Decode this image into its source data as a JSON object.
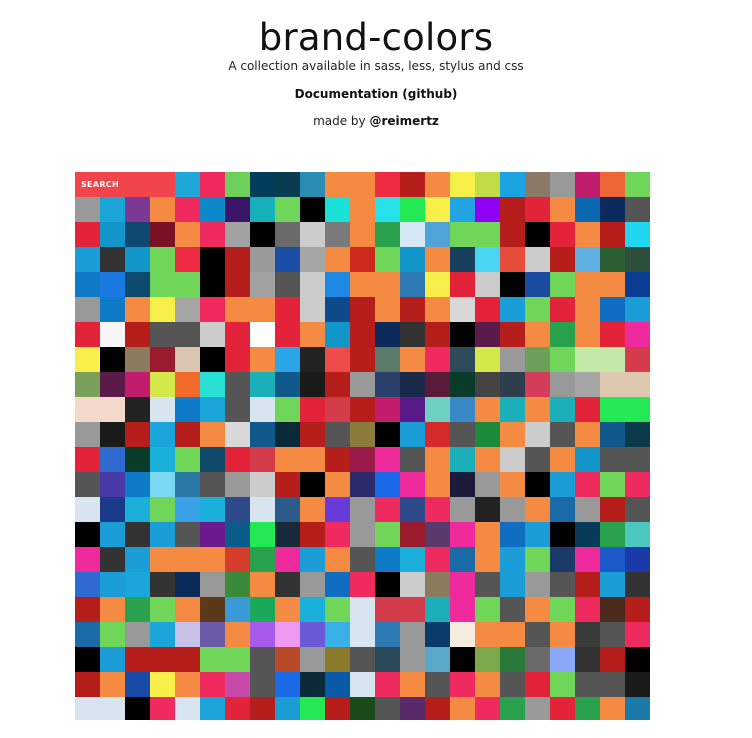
{
  "header": {
    "title": "brand-colors",
    "subtitle": "A collection available in sass, less, stylus and css",
    "documentation_link": "Documentation (github)",
    "made_by_prefix": "made by ",
    "made_by_handle": "@reimertz"
  },
  "search": {
    "placeholder": "SEARCH",
    "background_color": "#f2454b"
  },
  "palette": {
    "columns": 23,
    "first_row_after_search": [
      "#1ea8da",
      "#ee2a5e",
      "#6dd05a",
      "#043c5b",
      "#0a3c4f",
      "#2b8db4",
      "#f58a42",
      "#f58a42",
      "#ef2b43",
      "#b51e1b",
      "#f58a42",
      "#f9ef4b",
      "#c0dc46",
      "#1ba4e1",
      "#8a7a67",
      "#999999",
      "#c21d6c",
      "#ee6537",
      "#6fd65a"
    ],
    "colors": [
      "#999999",
      "#1ba6d9",
      "#7b3894",
      "#f58a42",
      "#ee2a5e",
      "#0c89c9",
      "#3c1568",
      "#15b0b9",
      "#6fd65a",
      "#000000",
      "#1be0d6",
      "#f58a42",
      "#26e2e8",
      "#25e855",
      "#f9ef4b",
      "#22a4e3",
      "#8f00f5",
      "#b51e1b",
      "#e2233a",
      "#f58a42",
      "#0c6ab3",
      "#0c2a5c",
      "#555555",
      "#e2233a",
      "#1296c9",
      "#0f4870",
      "#7a1225",
      "#f58a42",
      "#ee2a5e",
      "#a2a2a2",
      "#000000",
      "#6a6a6a",
      "#cccccc",
      "#7a7a7a",
      "#f58a42",
      "#2aa14d",
      "#d4e9f5",
      "#4fa3d9",
      "#6fd65a",
      "#6fd65a",
      "#b51e1b",
      "#000000",
      "#e2233a",
      "#f58a42",
      "#b51e1b",
      "#21d6f0",
      "#1b9dd7",
      "#333333",
      "#1296c9",
      "#6fd65a",
      "#ef2b43",
      "#000000",
      "#b51e1b",
      "#9a9a9a",
      "#1b4ea6",
      "#a5a5a5",
      "#f58a42",
      "#cc2a1c",
      "#6fd65a",
      "#1296c9",
      "#f58a42",
      "#1a3f5c",
      "#4ad5f5",
      "#e64c3a",
      "#cccccc",
      "#b51e1b",
      "#5fb0e0",
      "#2e5e34",
      "#2c4e3a",
      "#0f7bc8",
      "#1b7ae2",
      "#0c4a6e",
      "#6fd65a",
      "#6fd65a",
      "#000000",
      "#b51e1b",
      "#a2a2a2",
      "#555555",
      "#cccccc",
      "#1e88e5",
      "#f58a42",
      "#f58a42",
      "#2e7ab5",
      "#f9ef4b",
      "#e2233a",
      "#cccccc",
      "#000000",
      "#1a4ba0",
      "#6fd65a",
      "#f58a42",
      "#f58a42",
      "#0b3e93",
      "#999999",
      "#0f7bc8",
      "#f58a42",
      "#f9ef4b",
      "#a5a5a5",
      "#ee2a5e",
      "#f58a42",
      "#f58a42",
      "#e2233a",
      "#cccccc",
      "#0f4a8a",
      "#b51e1b",
      "#f58a42",
      "#b51e1b",
      "#f58a42",
      "#d8d8d8",
      "#e2233a",
      "#1b9dd7",
      "#6fd65a",
      "#e2233a",
      "#f58a42",
      "#0f6ec2",
      "#1b9dd7",
      "#e2233a",
      "#f6f6f6",
      "#b51e1b",
      "#555555",
      "#555555",
      "#cccccc",
      "#e2233a",
      "#ffffff",
      "#e2233a",
      "#f58a42",
      "#1296c9",
      "#b51e1b",
      "#0c2a5c",
      "#333333",
      "#b51e1b",
      "#000000",
      "#5b1b4a",
      "#b51e1b",
      "#f58a42",
      "#2aa14d",
      "#f58a42",
      "#e2233a",
      "#ee2a9c",
      "#f9ef4b",
      "#000000",
      "#8b7c5e",
      "#9a1b2e",
      "#d8c6b0",
      "#000000",
      "#e2233a",
      "#f58a42",
      "#2aa6e8",
      "#222222",
      "#ef4b4b",
      "#b51e1b",
      "#5a7a6a",
      "#f58a42",
      "#ee2a5e",
      "#2e4a5a",
      "#d4e84a",
      "#999999",
      "#6ca05a",
      "#6fd65a",
      "#c3e9a8",
      "#c3e9a8",
      "#d43c4c",
      "#7aa05a",
      "#5a1b4a",
      "#c21d6c",
      "#d4e84a",
      "#f26a2c",
      "#28e0d4",
      "#555555",
      "#1bb0b9",
      "#0f5a8a",
      "#1a1a1a",
      "#b51e1b",
      "#999999",
      "#2a3f6a",
      "#1a2a4a",
      "#5a1b3a",
      "#0a3a2a",
      "#444444",
      "#2e3e4e",
      "#d43c5c",
      "#999999",
      "#a5a5a5",
      "#dfc8b0",
      "#dfc8b0",
      "#f5d8cc",
      "#f5d8cc",
      "#222222",
      "#d8e4ef",
      "#0f7bc8",
      "#1ba6d9",
      "#555555",
      "#d8e4ef",
      "#6fd65a",
      "#e2233a",
      "#d43c4c",
      "#b51e1b",
      "#c21d6c",
      "#5a1b8a",
      "#6dd0c0",
      "#3a88c8",
      "#f58a42",
      "#1bb0b9",
      "#f58a42",
      "#1bb0b9",
      "#e2233a",
      "#25e855",
      "#25e855",
      "#999999",
      "#1a1a1a",
      "#b51e1b",
      "#1ba6d9",
      "#b51e1b",
      "#f58a42",
      "#d8d8d8",
      "#0f5a8a",
      "#0a2a3a",
      "#b51e1b",
      "#555555",
      "#8b7c3e",
      "#000000",
      "#1b9dd7",
      "#d42a2a",
      "#555555",
      "#1b8a3a",
      "#f58a42",
      "#cccccc",
      "#555555",
      "#f58a42",
      "#0f5a8a",
      "#0a3a4a",
      "#e2233a",
      "#2e6ad0",
      "#0a3a2a",
      "#1bb0d9",
      "#6fd65a",
      "#0f4a6a",
      "#e2233a",
      "#d43c4c",
      "#f58a42",
      "#f58a42",
      "#b51e1b",
      "#9a1b4a",
      "#ee2a9c",
      "#555555",
      "#f58a42",
      "#1bb0b9",
      "#f58a42",
      "#cccccc",
      "#555555",
      "#f58a42",
      "#1296c9",
      "#555555",
      "#555555",
      "#555555",
      "#4a3aa8",
      "#0f7bc8",
      "#7ad8f0",
      "#2a7aa8",
      "#555555",
      "#999999",
      "#cccccc",
      "#b51e1b",
      "#000000",
      "#f58a42",
      "#2a2a6a",
      "#1a6ae8",
      "#ee2a9c",
      "#f58a42",
      "#1a1a3a",
      "#999999",
      "#f58a42",
      "#000000",
      "#1b9dd7",
      "#ee2a5e",
      "#6fd65a",
      "#ee2a5e",
      "#d8e4ef",
      "#1a3a8a",
      "#1bb0d9",
      "#6fd65a",
      "#3aa0e8",
      "#1bb0d9",
      "#2e4a8a",
      "#d8e4ef",
      "#2e5a8a",
      "#f58a42",
      "#6a3ad8",
      "#999999",
      "#ee2a5e",
      "#2e4a8a",
      "#ee2a5e",
      "#999999",
      "#222222",
      "#999999",
      "#f58a42",
      "#1a6aa8",
      "#999999",
      "#b51e1b",
      "#555555",
      "#000000",
      "#1b9dd7",
      "#333333",
      "#1b9dd7",
      "#555555",
      "#6a1a8a",
      "#0a5a8a",
      "#25e855",
      "#1a2a3a",
      "#b51e1b",
      "#ee2a5e",
      "#999999",
      "#6fd65a",
      "#9a1b2e",
      "#5a3a6a",
      "#ee2a9c",
      "#f58a42",
      "#0f6ec2",
      "#1b9dd7",
      "#000000",
      "#0a3a5a",
      "#2aa14d",
      "#4ac8c0",
      "#ee2a9c",
      "#333333",
      "#1b9dd7",
      "#f58a42",
      "#f58a42",
      "#f58a42",
      "#d43c2c",
      "#2aa14d",
      "#ee2a9c",
      "#1b9dd7",
      "#f58a42",
      "#555555",
      "#0f7bc8",
      "#1bb0d9",
      "#ee2a5e",
      "#1a6aa8",
      "#f58a42",
      "#1b9dd7",
      "#6fd65a",
      "#1a3a6a",
      "#ee2a9c",
      "#1b5ac8",
      "#1a3aa8",
      "#2e6ad0",
      "#1b9dd7",
      "#1ba6d9",
      "#333333",
      "#0a2a5a",
      "#999999",
      "#3a8a3a",
      "#f58a42",
      "#333333",
      "#999999",
      "#0f6ec2",
      "#ee2a5e",
      "#000000",
      "#cccccc",
      "#8b7c5e",
      "#ee2a9c",
      "#555555",
      "#1b9dd7",
      "#999999",
      "#555555",
      "#b51e1b",
      "#1b9dd7",
      "#333333",
      "#b51e1b",
      "#f58a42",
      "#2aa14d",
      "#6fd65a",
      "#f58a42",
      "#5a3a1a",
      "#3a9ad8",
      "#1aa85a",
      "#f58a42",
      "#1bb0d9",
      "#6fd65a",
      "#d8e4ef",
      "#d43c4c",
      "#d43c4c",
      "#1bb0b9",
      "#ee2a9c",
      "#6fd65a",
      "#555555",
      "#f58a42",
      "#6fd65a",
      "#ee2a5e",
      "#4a2a1a",
      "#b51e1b",
      "#1a6aa8",
      "#6fd65a",
      "#999999",
      "#1ba6d9",
      "#c8c0e8",
      "#6a5aa8",
      "#f58a42",
      "#a85ae8",
      "#ee9af0",
      "#6a5ad8",
      "#3ab0e8",
      "#d8e4ef",
      "#2e7ab5",
      "#999999",
      "#0a3a6a",
      "#f5ece0",
      "#f58a42",
      "#f58a42",
      "#555555",
      "#f58a42",
      "#3a3a3a",
      "#555555",
      "#ee2a5e",
      "#000000",
      "#1b9dd7",
      "#b51e1b",
      "#b51e1b",
      "#b51e1b",
      "#6fd65a",
      "#6fd65a",
      "#555555",
      "#b84a2a",
      "#999999",
      "#8a7a2a",
      "#555555",
      "#2a4a5a",
      "#999999",
      "#5aa8c8",
      "#000000",
      "#7aa84a",
      "#2a7a3a",
      "#6a6a6a",
      "#8aa8f8",
      "#333333",
      "#b51e1b",
      "#000000",
      "#b51e1b",
      "#f58a42",
      "#1a4aa8",
      "#f9ef4b",
      "#f58a42",
      "#ee2a5e",
      "#c84aa8",
      "#555555",
      "#1a6ae8",
      "#0a2a3a",
      "#0a5aa8",
      "#d8e4ef",
      "#ee2a5e",
      "#f58a42",
      "#555555",
      "#ee2a5e",
      "#f58a42",
      "#555555",
      "#e2233a",
      "#6fd65a",
      "#555555",
      "#555555",
      "#1a1a1a",
      "#d8e4ef",
      "#d8e4ef",
      "#000000",
      "#ee2a5e",
      "#d8e4ef",
      "#1ba6d9",
      "#e2233a",
      "#b51e1b",
      "#1b9dd7",
      "#25e855",
      "#b51e1b",
      "#1a4a1a",
      "#555555",
      "#5a2a6a",
      "#b51e1b",
      "#f58a42",
      "#ee2a5e",
      "#2aa14d",
      "#999999",
      "#e2233a",
      "#2aa14d",
      "#f58a42",
      "#1a7aa8"
    ]
  }
}
